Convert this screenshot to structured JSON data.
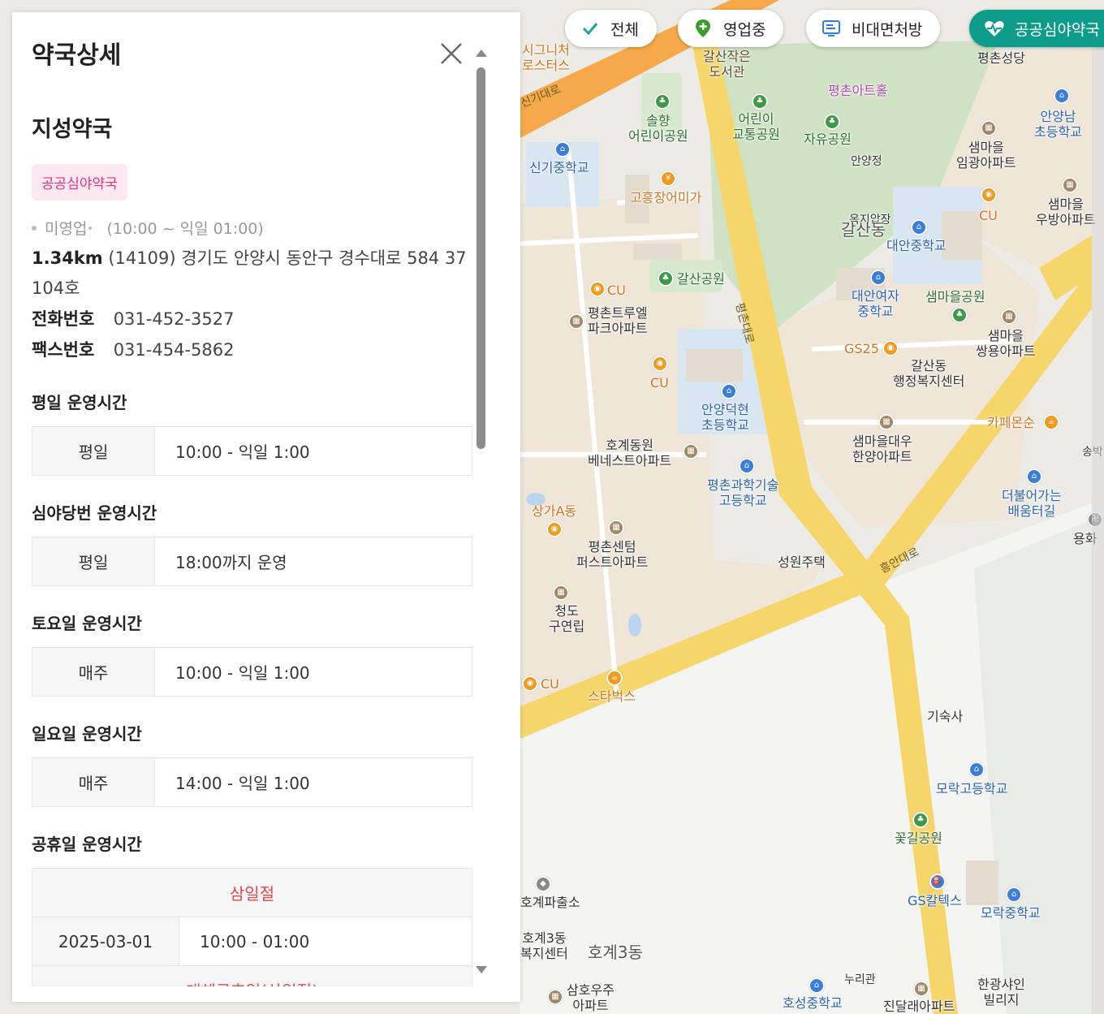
{
  "filters": [
    {
      "label": "전체",
      "icon": "check-icon",
      "active": false
    },
    {
      "label": "영업중",
      "icon": "location-pin-icon",
      "active": false
    },
    {
      "label": "비대면처방",
      "icon": "prescription-icon",
      "active": false
    },
    {
      "label": "공공심야약국",
      "icon": "heart-pulse-icon",
      "active": true
    }
  ],
  "panel": {
    "title": "약국상세",
    "name": "지성약국",
    "badge": "공공심야약국",
    "status": "미영업",
    "status_hours": "(10:00 ~ 익일 01:00)",
    "distance": "1.34km",
    "address": "(14109) 경기도 안양시 동안구 경수대로 584 37 104호",
    "phone_label": "전화번호",
    "phone": "031-452-3527",
    "fax_label": "팩스번호",
    "fax": "031-454-5862",
    "weekday": {
      "title": "평일 운영시간",
      "rows": [
        {
          "key": "평일",
          "value": "10:00 - 익일 1:00"
        }
      ]
    },
    "night": {
      "title": "심야당번 운영시간",
      "rows": [
        {
          "key": "평일",
          "value": "18:00까지 운영"
        }
      ]
    },
    "saturday": {
      "title": "토요일 운영시간",
      "rows": [
        {
          "key": "매주",
          "value": "10:00 - 익일 1:00"
        }
      ]
    },
    "sunday": {
      "title": "일요일 운영시간",
      "rows": [
        {
          "key": "매주",
          "value": "14:00 - 익일 1:00"
        }
      ]
    },
    "holiday": {
      "title": "공휴일 운영시간",
      "items": [
        {
          "name": "삼일절",
          "date": "2025-03-01",
          "hours": "10:00 - 01:00"
        },
        {
          "name": "대체공휴일(삼일절)"
        }
      ]
    }
  },
  "map": {
    "labels": {
      "l1": "시그니처\n로스터스",
      "l2": "갈산작은\n도서관",
      "l3": "평촌성당",
      "l4": "평촌아트홀",
      "l5": "솔향\n어린이공원",
      "l6": "어린이\n교통공원",
      "l7": "자유공원",
      "l8": "안양정",
      "l9": "안양남\n초등학교",
      "l10": "샘마을\n임광아파트",
      "l11": "신기중학교",
      "l12": "고흥장어미가",
      "l13": "샘마을\n우방아파트",
      "l14": "CU",
      "l15": "옥지압장",
      "l16": "갈산동",
      "l17": "대안중학교",
      "l18": "CU",
      "l19": "갈산공원",
      "l20": "대안여자\n중학교",
      "l21": "샘마을공원",
      "l22": "평촌트루엘\n파크아파트",
      "l23": "샘마을\n쌍용아파트",
      "l24": "GS25",
      "l25": "갈산동\n행정복지센터",
      "l26": "CU",
      "l27": "안양덕현\n초등학교",
      "l28": "카페몬순",
      "l29": "샘마을대우\n한양아파트",
      "l30": "호계동원\n베네스트아파트",
      "l31": "평촌과학기술\n고등학교",
      "l32": "더불어가는\n배움터길",
      "l33": "상가A동",
      "l34": "평촌센텀\n퍼스트아파트",
      "l35": "성원주택",
      "l36": "청도\n구연립",
      "l37": "CU",
      "l38": "스타벅스",
      "l39": "기숙사",
      "l40": "모락고등학교",
      "l41": "꽃길공원",
      "l42": "GS칼텍스",
      "l43": "모락중학교",
      "l44": "호계파출소",
      "l45": "호계3동\n복지센터",
      "l46": "호계3동",
      "l47": "누리관",
      "l48": "삼호우주\n아파트",
      "l49": "호성중학교",
      "l50": "진달래아파트",
      "l51": "한광샤인\n빌리지",
      "l52": "용화",
      "l53": "송박",
      "l54": "신기대로",
      "l55": "평촌대로",
      "l56": "흥안대로"
    }
  }
}
